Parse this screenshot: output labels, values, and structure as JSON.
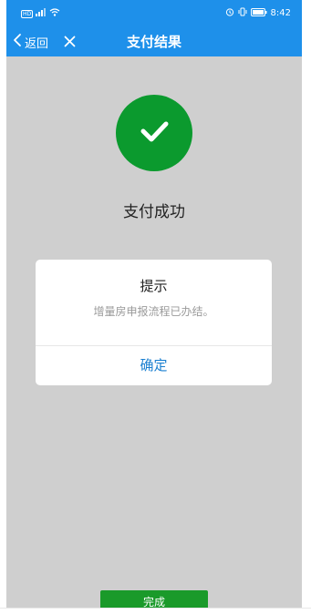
{
  "status_bar": {
    "time": "8:42",
    "hd_badge": "HD",
    "icons": [
      "hd-icon",
      "signal-icon",
      "wifi-icon",
      "alarm-icon",
      "vibrate-icon",
      "battery-icon"
    ]
  },
  "nav": {
    "back_label": "返回",
    "title": "支付结果",
    "icons": [
      "chevron-left-icon",
      "close-icon"
    ]
  },
  "result": {
    "icon": "checkmark-icon",
    "message": "支付成功"
  },
  "dialog": {
    "title": "提示",
    "message": "增量房申报流程已办结。",
    "confirm_label": "确定"
  },
  "footer": {
    "done_label": "完成"
  },
  "colors": {
    "header_blue": "#1e90ea",
    "success_green": "#0b9a2e",
    "overlay_gray": "#cfcfcf",
    "link_blue": "#1a7fd0"
  }
}
